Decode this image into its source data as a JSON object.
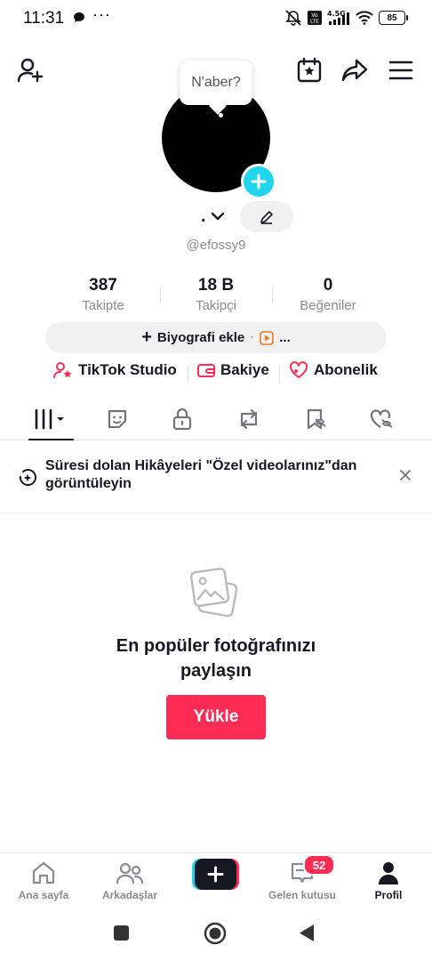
{
  "status_bar": {
    "time": "11:31",
    "dots": "···",
    "network": "4.5G",
    "volte": "Vo LTE",
    "battery": "85"
  },
  "header": {
    "icons": [
      "add-friend-icon",
      "calendar-star-icon",
      "share-icon",
      "menu-icon"
    ]
  },
  "profile": {
    "bubble_text": "N'aber?",
    "display_name": ".",
    "handle": "@efossy9",
    "stats": [
      {
        "value": "387",
        "label": "Takipte"
      },
      {
        "value": "18 B",
        "label": "Takipçi"
      },
      {
        "value": "0",
        "label": "Beğeniler"
      }
    ],
    "bio_button": {
      "plus": "+",
      "label": "Biyografi ekle",
      "sep": "·",
      "more": "..."
    }
  },
  "links": [
    {
      "label": "TikTok Studio",
      "icon": "person-star-icon"
    },
    {
      "label": "Bakiye",
      "icon": "wallet-icon"
    },
    {
      "label": "Abonelik",
      "icon": "heart-star-icon"
    }
  ],
  "tabs": [
    "videos-grid-icon",
    "sticker-icon",
    "lock-icon",
    "repost-icon",
    "bookmark-icon",
    "liked-icon"
  ],
  "notice": {
    "text": "Süresi dolan Hikâyeleri \"Özel videolarınız\"dan görüntüleyin",
    "close": "×"
  },
  "empty_state": {
    "title": "En popüler fotoğrafınızı paylaşın",
    "button": "Yükle"
  },
  "bottom_nav": {
    "items": [
      {
        "label": "Ana sayfa",
        "icon": "home-icon"
      },
      {
        "label": "Arkadaşlar",
        "icon": "friends-icon"
      },
      {
        "label": "",
        "icon": "create-icon"
      },
      {
        "label": "Gelen kutusu",
        "icon": "inbox-icon",
        "badge": "52"
      },
      {
        "label": "Profil",
        "icon": "profile-icon"
      }
    ]
  },
  "colors": {
    "accent": "#fe2c55",
    "cyan": "#20d5ec",
    "text": "#161823",
    "muted": "#8a8b91"
  }
}
